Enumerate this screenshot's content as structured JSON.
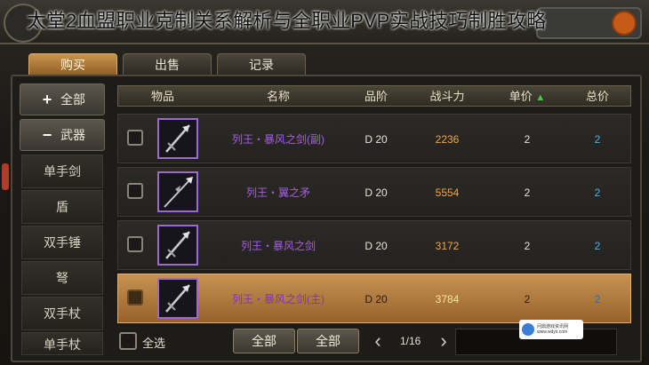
{
  "overlay_title": "太堂2血盟职业克制关系解析与全职业PVP实战技巧制胜攻略",
  "tabs": [
    {
      "label": "购买",
      "active": true
    },
    {
      "label": "出售",
      "active": false
    },
    {
      "label": "记录",
      "active": false
    }
  ],
  "sidebar": {
    "all_label": "全部",
    "all_icon": "plus-icon",
    "weapon_label": "武器",
    "weapon_icon": "minus-icon",
    "items": [
      "单手剑",
      "盾",
      "双手锤",
      "弩",
      "双手杖",
      "单手杖"
    ]
  },
  "table": {
    "headers": {
      "item": "物品",
      "name": "名称",
      "grade": "品阶",
      "power": "战斗力",
      "unit_price": "单价",
      "total_price": "总价"
    },
    "sort_icon": "sort-up-icon",
    "rows": [
      {
        "name": "列王・暴风之剑(副)",
        "grade": "D  20",
        "power": "2236",
        "unit": "2",
        "total": "2",
        "selected": false,
        "icon": "sword-icon"
      },
      {
        "name": "列王・翼之矛",
        "grade": "D  20",
        "power": "5554",
        "unit": "2",
        "total": "2",
        "selected": false,
        "icon": "spear-icon"
      },
      {
        "name": "列王・暴风之剑",
        "grade": "D  20",
        "power": "3172",
        "unit": "2",
        "total": "2",
        "selected": false,
        "icon": "sword-icon"
      },
      {
        "name": "列王・暴风之剑(主)",
        "grade": "D  20",
        "power": "3784",
        "unit": "2",
        "total": "2",
        "selected": true,
        "icon": "sword-icon"
      }
    ]
  },
  "bottom": {
    "select_all_label": "全选",
    "btn1_label": "全部",
    "btn2_label": "全部",
    "page_text": "1/16"
  },
  "watermark": {
    "line1": "问鼎游戏资讯网",
    "line2": "www.wdyx.com"
  },
  "colors": {
    "accent_tab": "#c9954f",
    "name_purple": "#a65ee0",
    "power_orange": "#f1a64a",
    "total_blue": "#4fb0ea",
    "sort_green": "#3bd13b"
  }
}
